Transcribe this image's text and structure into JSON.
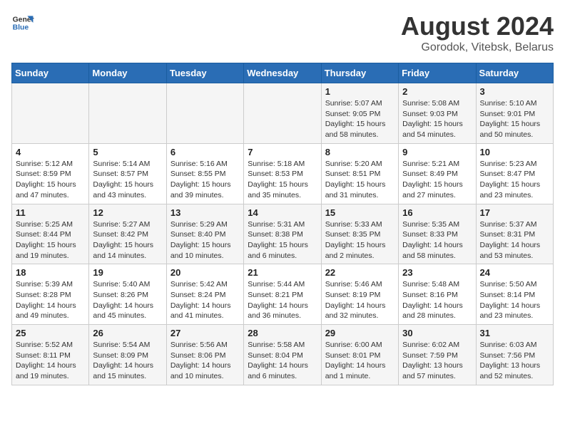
{
  "header": {
    "logo_line1": "General",
    "logo_line2": "Blue",
    "main_title": "August 2024",
    "subtitle": "Gorodok, Vitebsk, Belarus"
  },
  "days_of_week": [
    "Sunday",
    "Monday",
    "Tuesday",
    "Wednesday",
    "Thursday",
    "Friday",
    "Saturday"
  ],
  "weeks": [
    [
      {
        "day": "",
        "info": ""
      },
      {
        "day": "",
        "info": ""
      },
      {
        "day": "",
        "info": ""
      },
      {
        "day": "",
        "info": ""
      },
      {
        "day": "1",
        "info": "Sunrise: 5:07 AM\nSunset: 9:05 PM\nDaylight: 15 hours\nand 58 minutes."
      },
      {
        "day": "2",
        "info": "Sunrise: 5:08 AM\nSunset: 9:03 PM\nDaylight: 15 hours\nand 54 minutes."
      },
      {
        "day": "3",
        "info": "Sunrise: 5:10 AM\nSunset: 9:01 PM\nDaylight: 15 hours\nand 50 minutes."
      }
    ],
    [
      {
        "day": "4",
        "info": "Sunrise: 5:12 AM\nSunset: 8:59 PM\nDaylight: 15 hours\nand 47 minutes."
      },
      {
        "day": "5",
        "info": "Sunrise: 5:14 AM\nSunset: 8:57 PM\nDaylight: 15 hours\nand 43 minutes."
      },
      {
        "day": "6",
        "info": "Sunrise: 5:16 AM\nSunset: 8:55 PM\nDaylight: 15 hours\nand 39 minutes."
      },
      {
        "day": "7",
        "info": "Sunrise: 5:18 AM\nSunset: 8:53 PM\nDaylight: 15 hours\nand 35 minutes."
      },
      {
        "day": "8",
        "info": "Sunrise: 5:20 AM\nSunset: 8:51 PM\nDaylight: 15 hours\nand 31 minutes."
      },
      {
        "day": "9",
        "info": "Sunrise: 5:21 AM\nSunset: 8:49 PM\nDaylight: 15 hours\nand 27 minutes."
      },
      {
        "day": "10",
        "info": "Sunrise: 5:23 AM\nSunset: 8:47 PM\nDaylight: 15 hours\nand 23 minutes."
      }
    ],
    [
      {
        "day": "11",
        "info": "Sunrise: 5:25 AM\nSunset: 8:44 PM\nDaylight: 15 hours\nand 19 minutes."
      },
      {
        "day": "12",
        "info": "Sunrise: 5:27 AM\nSunset: 8:42 PM\nDaylight: 15 hours\nand 14 minutes."
      },
      {
        "day": "13",
        "info": "Sunrise: 5:29 AM\nSunset: 8:40 PM\nDaylight: 15 hours\nand 10 minutes."
      },
      {
        "day": "14",
        "info": "Sunrise: 5:31 AM\nSunset: 8:38 PM\nDaylight: 15 hours\nand 6 minutes."
      },
      {
        "day": "15",
        "info": "Sunrise: 5:33 AM\nSunset: 8:35 PM\nDaylight: 15 hours\nand 2 minutes."
      },
      {
        "day": "16",
        "info": "Sunrise: 5:35 AM\nSunset: 8:33 PM\nDaylight: 14 hours\nand 58 minutes."
      },
      {
        "day": "17",
        "info": "Sunrise: 5:37 AM\nSunset: 8:31 PM\nDaylight: 14 hours\nand 53 minutes."
      }
    ],
    [
      {
        "day": "18",
        "info": "Sunrise: 5:39 AM\nSunset: 8:28 PM\nDaylight: 14 hours\nand 49 minutes."
      },
      {
        "day": "19",
        "info": "Sunrise: 5:40 AM\nSunset: 8:26 PM\nDaylight: 14 hours\nand 45 minutes."
      },
      {
        "day": "20",
        "info": "Sunrise: 5:42 AM\nSunset: 8:24 PM\nDaylight: 14 hours\nand 41 minutes."
      },
      {
        "day": "21",
        "info": "Sunrise: 5:44 AM\nSunset: 8:21 PM\nDaylight: 14 hours\nand 36 minutes."
      },
      {
        "day": "22",
        "info": "Sunrise: 5:46 AM\nSunset: 8:19 PM\nDaylight: 14 hours\nand 32 minutes."
      },
      {
        "day": "23",
        "info": "Sunrise: 5:48 AM\nSunset: 8:16 PM\nDaylight: 14 hours\nand 28 minutes."
      },
      {
        "day": "24",
        "info": "Sunrise: 5:50 AM\nSunset: 8:14 PM\nDaylight: 14 hours\nand 23 minutes."
      }
    ],
    [
      {
        "day": "25",
        "info": "Sunrise: 5:52 AM\nSunset: 8:11 PM\nDaylight: 14 hours\nand 19 minutes."
      },
      {
        "day": "26",
        "info": "Sunrise: 5:54 AM\nSunset: 8:09 PM\nDaylight: 14 hours\nand 15 minutes."
      },
      {
        "day": "27",
        "info": "Sunrise: 5:56 AM\nSunset: 8:06 PM\nDaylight: 14 hours\nand 10 minutes."
      },
      {
        "day": "28",
        "info": "Sunrise: 5:58 AM\nSunset: 8:04 PM\nDaylight: 14 hours\nand 6 minutes."
      },
      {
        "day": "29",
        "info": "Sunrise: 6:00 AM\nSunset: 8:01 PM\nDaylight: 14 hours\nand 1 minute."
      },
      {
        "day": "30",
        "info": "Sunrise: 6:02 AM\nSunset: 7:59 PM\nDaylight: 13 hours\nand 57 minutes."
      },
      {
        "day": "31",
        "info": "Sunrise: 6:03 AM\nSunset: 7:56 PM\nDaylight: 13 hours\nand 52 minutes."
      }
    ]
  ]
}
